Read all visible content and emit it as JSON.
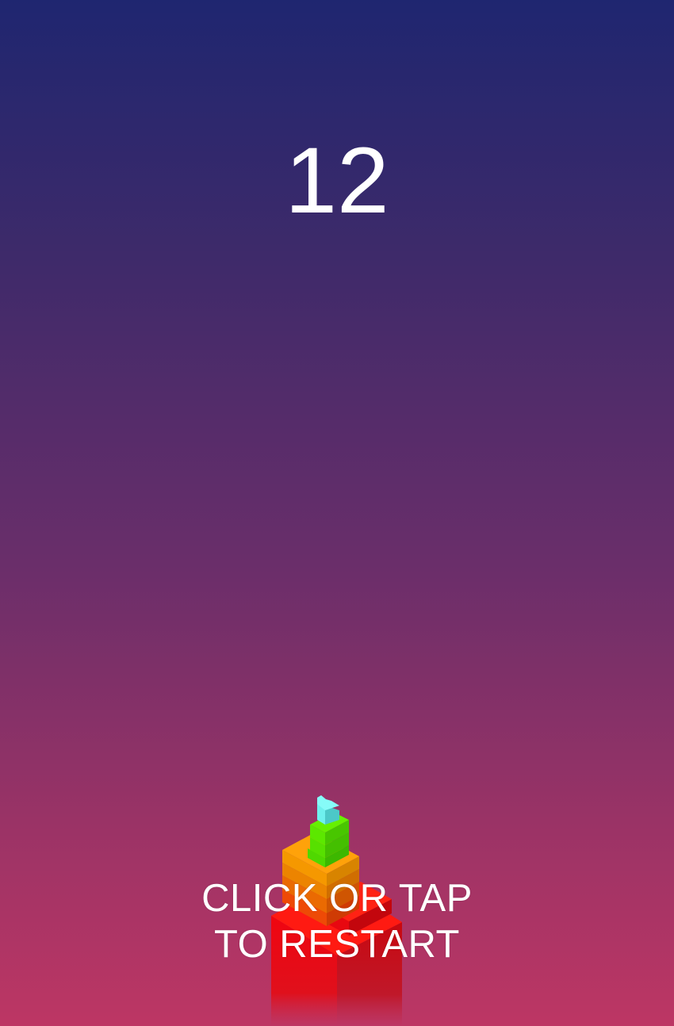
{
  "game": {
    "score": "12",
    "restart_line1": "CLICK OR TAP",
    "restart_line2": "TO RESTART"
  },
  "colors": {
    "background_top": "#1f2670",
    "background_bottom": "#bd3664",
    "block_red": "#e40a12",
    "block_orange": "#f08a00",
    "block_green": "#55e000",
    "block_cyan": "#5fe3e0"
  }
}
